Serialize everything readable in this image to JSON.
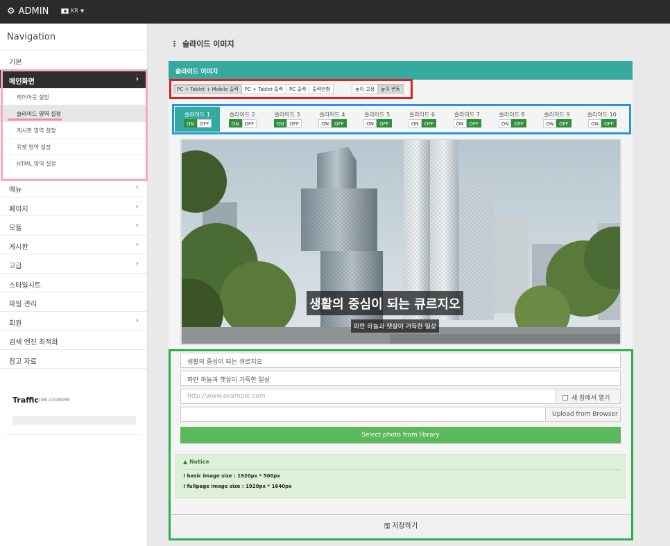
{
  "topbar": {
    "brand": "ADMIN",
    "lang": "KR"
  },
  "sidebar": {
    "title": "Navigation",
    "item_basic": "기본",
    "item_main": "메인화면",
    "sub_items": [
      "레이아웃 설정",
      "슬라이드 영역 설정",
      "게시판 영역 설정",
      "위젯 영역 설정",
      "HTML 영역 설정"
    ],
    "items": [
      "메뉴",
      "페이지",
      "모듈",
      "게시판",
      "고급",
      "스타일시트",
      "파일 관리",
      "회원",
      "검색 엔진 최적화",
      "참고 자료"
    ],
    "traffic": {
      "title": "Traffic",
      "usage": "2MB /20480MB"
    }
  },
  "main": {
    "heading": "슬라이드 이미지",
    "panel_title": "슬라이드 이미지",
    "output_buttons": [
      "PC + Tablet + Mobile 출력",
      "PC + Tablet 출력",
      "PC 출력",
      "출력안함"
    ],
    "height_buttons": [
      "높이 고정",
      "높이 변동"
    ],
    "slides": [
      {
        "label": "슬라이드 1",
        "state": "on"
      },
      {
        "label": "슬라이드 2",
        "state": "on"
      },
      {
        "label": "슬라이드 3",
        "state": "on"
      },
      {
        "label": "슬라이드 4",
        "state": "off"
      },
      {
        "label": "슬라이드 5",
        "state": "off"
      },
      {
        "label": "슬라이드 6",
        "state": "off"
      },
      {
        "label": "슬라이드 7",
        "state": "off"
      },
      {
        "label": "슬라이드 8",
        "state": "off"
      },
      {
        "label": "슬라이드 9",
        "state": "off"
      },
      {
        "label": "슬라이드 10",
        "state": "off"
      }
    ],
    "toggle_on": "ON",
    "toggle_off": "OFF",
    "hero": {
      "title": "생활의 중심이 되는 큐르지오",
      "subtitle": "파란 하늘과 햇살이 가득한 일상"
    },
    "form": {
      "title_value": "생활의 중심이 되는 큐르지오",
      "subtitle_value": "파란 하늘과 햇살이 가득한 일상",
      "url_placeholder": "http://www.example.com",
      "new_window_label": "새 창에서 열기",
      "upload_label": "Upload from Browser",
      "select_photo_label": "Select photo from library"
    },
    "notice": {
      "title": "Notice",
      "lines": [
        "! basic image size : 1920px * 500px",
        "! fullpage image size : 1920px * 1640px"
      ]
    },
    "save_label": "저장하기"
  },
  "colors": {
    "accent": "#35aba0",
    "on_green": "#2f8f3a",
    "button_green": "#5cb85c",
    "red_box": "#e02020",
    "blue_box": "#2196e8",
    "green_box": "#28b04a",
    "pink_box": "#f5a8c8"
  }
}
